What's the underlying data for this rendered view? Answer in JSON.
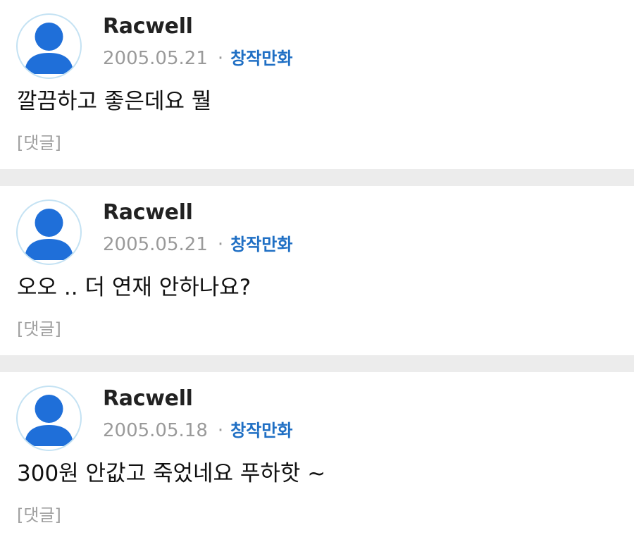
{
  "comments": [
    {
      "author": "Racwell",
      "date": "2005.05.21",
      "separator": "·",
      "category": "창작만화",
      "text": "깔끔하고 좋은데요 뭘",
      "reply_label": "[댓글]"
    },
    {
      "author": "Racwell",
      "date": "2005.05.21",
      "separator": "·",
      "category": "창작만화",
      "text": "오오 .. 더 연재 안하나요?",
      "reply_label": "[댓글]"
    },
    {
      "author": "Racwell",
      "date": "2005.05.18",
      "separator": "·",
      "category": "창작만화",
      "text": "300원 안값고 죽었네요 푸하핫 ~",
      "reply_label": "[댓글]"
    }
  ],
  "icons": {
    "avatar": "user-avatar-icon"
  },
  "colors": {
    "avatar_fill": "#1f6fd9",
    "avatar_ring": "#c4e2f3",
    "category": "#1f6fc4",
    "meta": "#9a9a9a",
    "divider": "#ececec"
  }
}
